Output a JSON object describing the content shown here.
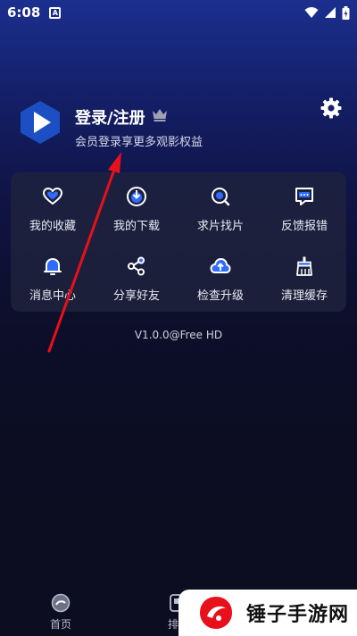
{
  "status_bar": {
    "time": "6:08",
    "notification_icon_label": "A",
    "icons": [
      "wifi-icon",
      "signal-icon",
      "battery-icon"
    ]
  },
  "profile": {
    "title": "登录/注册",
    "subtitle": "会员登录享更多观影权益",
    "logo_icon": "play-logo-icon",
    "crown_icon": "crown-icon"
  },
  "settings_icon": "gear-icon",
  "menu": {
    "items": [
      {
        "label": "我的收藏",
        "icon": "heart-icon"
      },
      {
        "label": "我的下载",
        "icon": "download-icon"
      },
      {
        "label": "求片找片",
        "icon": "search-film-icon"
      },
      {
        "label": "反馈报错",
        "icon": "feedback-icon"
      },
      {
        "label": "消息中心",
        "icon": "bell-icon"
      },
      {
        "label": "分享好友",
        "icon": "share-icon"
      },
      {
        "label": "检查升级",
        "icon": "upgrade-icon"
      },
      {
        "label": "清理缓存",
        "icon": "broom-icon"
      }
    ]
  },
  "version": "V1.0.0@Free HD",
  "bottom_nav": {
    "home_label": "首页",
    "rank_label": "排行"
  },
  "watermark": {
    "text": "锤子手游网"
  },
  "colors": {
    "accent": "#2f6bff",
    "logo_blue": "#1d4fc4",
    "annotation_red": "#e8101a"
  }
}
